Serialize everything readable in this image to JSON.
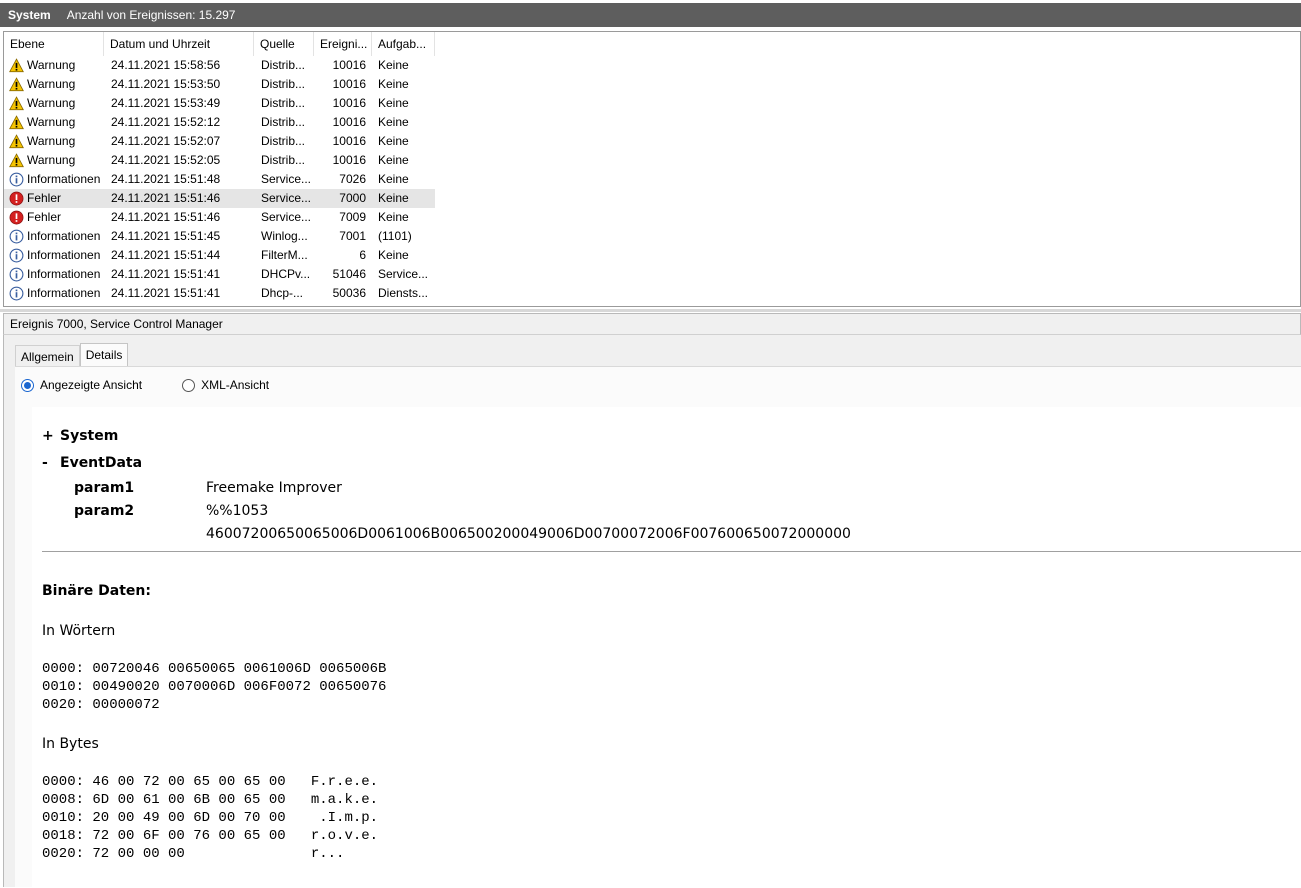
{
  "titlebar": {
    "title": "System",
    "count_text": "Anzahl von Ereignissen: 15.297"
  },
  "columns": [
    "Ebene",
    "Datum und Uhrzeit",
    "Quelle",
    "Ereigni...",
    "Aufgab..."
  ],
  "events": [
    {
      "type": "warning",
      "level": "Warnung",
      "date": "24.11.2021 15:58:56",
      "source": "Distrib...",
      "id": "10016",
      "task": "Keine"
    },
    {
      "type": "warning",
      "level": "Warnung",
      "date": "24.11.2021 15:53:50",
      "source": "Distrib...",
      "id": "10016",
      "task": "Keine"
    },
    {
      "type": "warning",
      "level": "Warnung",
      "date": "24.11.2021 15:53:49",
      "source": "Distrib...",
      "id": "10016",
      "task": "Keine"
    },
    {
      "type": "warning",
      "level": "Warnung",
      "date": "24.11.2021 15:52:12",
      "source": "Distrib...",
      "id": "10016",
      "task": "Keine"
    },
    {
      "type": "warning",
      "level": "Warnung",
      "date": "24.11.2021 15:52:07",
      "source": "Distrib...",
      "id": "10016",
      "task": "Keine"
    },
    {
      "type": "warning",
      "level": "Warnung",
      "date": "24.11.2021 15:52:05",
      "source": "Distrib...",
      "id": "10016",
      "task": "Keine"
    },
    {
      "type": "info",
      "level": "Informationen",
      "date": "24.11.2021 15:51:48",
      "source": "Service...",
      "id": "7026",
      "task": "Keine"
    },
    {
      "type": "error",
      "level": "Fehler",
      "date": "24.11.2021 15:51:46",
      "source": "Service...",
      "id": "7000",
      "task": "Keine",
      "selected": true
    },
    {
      "type": "error",
      "level": "Fehler",
      "date": "24.11.2021 15:51:46",
      "source": "Service...",
      "id": "7009",
      "task": "Keine"
    },
    {
      "type": "info",
      "level": "Informationen",
      "date": "24.11.2021 15:51:45",
      "source": "Winlog...",
      "id": "7001",
      "task": "(1101)"
    },
    {
      "type": "info",
      "level": "Informationen",
      "date": "24.11.2021 15:51:44",
      "source": "FilterM...",
      "id": "6",
      "task": "Keine"
    },
    {
      "type": "info",
      "level": "Informationen",
      "date": "24.11.2021 15:51:41",
      "source": "DHCPv...",
      "id": "51046",
      "task": "Service..."
    },
    {
      "type": "info",
      "level": "Informationen",
      "date": "24.11.2021 15:51:41",
      "source": "Dhcp-...",
      "id": "50036",
      "task": "Diensts..."
    }
  ],
  "detail": {
    "header": "Ereignis 7000, Service Control Manager",
    "tabs": [
      "Allgemein",
      "Details"
    ],
    "active_tab": "Details",
    "view_options": {
      "friendly": "Angezeigte Ansicht",
      "xml": "XML-Ansicht",
      "selected": "friendly"
    },
    "tree": {
      "system_sym": "+",
      "system_label": "System",
      "eventdata_sym": "-",
      "eventdata_label": "EventData",
      "param1_key": "param1",
      "param1_value": "Freemake Improver",
      "param2_key": "param2",
      "param2_value": "%%1053",
      "binary_value": "46007200650065006D0061006B006500200049006D00700072006F007600650072000000"
    },
    "binary_title": "Binäre Daten:",
    "words_title": "In Wörtern",
    "words_dump": "0000: 00720046 00650065 0061006D 0065006B\n0010: 00490020 0070006D 006F0072 00650076\n0020: 00000072",
    "bytes_title": "In Bytes",
    "bytes_dump": "0000: 46 00 72 00 65 00 65 00   F.r.e.e.\n0008: 6D 00 61 00 6B 00 65 00   m.a.k.e.\n0010: 20 00 49 00 6D 00 70 00    .I.m.p.\n0018: 72 00 6F 00 76 00 65 00   r.o.v.e.\n0020: 72 00 00 00               r..."
  },
  "colors": {
    "titlebar": "#5e5e5e",
    "selected_row": "#e5e5e5",
    "radio_accent": "#1a66d0",
    "error": "#d42020",
    "warning": "#f5c400",
    "info": "#ffffff"
  }
}
